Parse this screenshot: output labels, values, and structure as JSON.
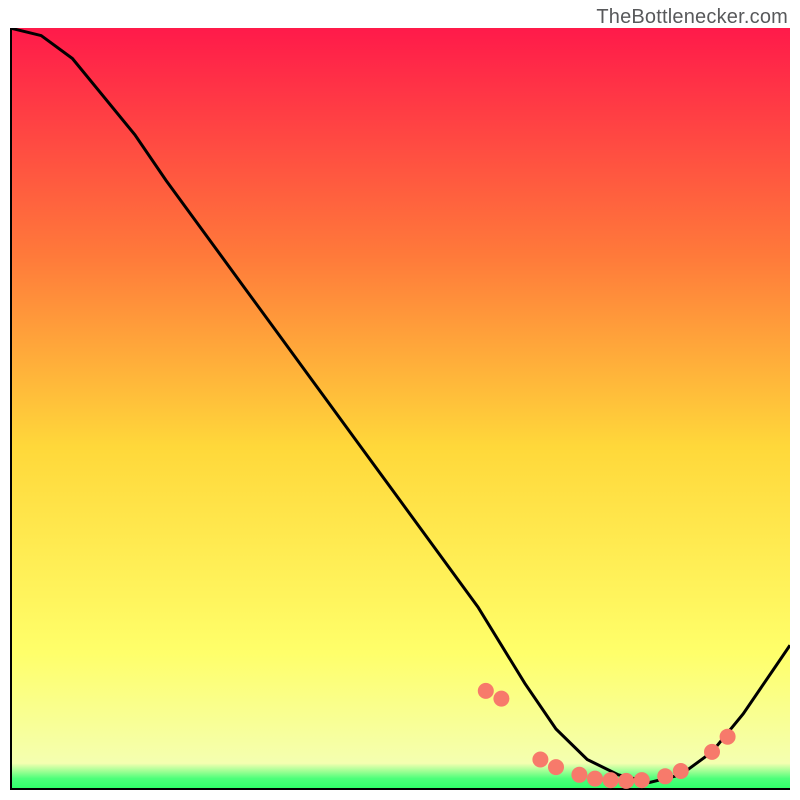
{
  "source_label": "TheBottlenecker.com",
  "colors": {
    "gradient_top": "#ff1a4a",
    "gradient_mid_top": "#ff7a3a",
    "gradient_mid": "#ffd83a",
    "gradient_mid_bottom": "#ffff6a",
    "gradient_bottom": "#4dff7a",
    "curve": "#000000",
    "axis": "#000000",
    "points": "#f77a6b"
  },
  "chart_data": {
    "type": "line",
    "title": "",
    "xlabel": "",
    "ylabel": "",
    "xlim": [
      0,
      100
    ],
    "ylim": [
      0,
      100
    ],
    "curve": {
      "x": [
        0,
        4,
        8,
        12,
        16,
        20,
        25,
        30,
        35,
        40,
        45,
        50,
        55,
        60,
        63,
        66,
        70,
        74,
        78,
        82,
        86,
        90,
        94,
        98,
        100
      ],
      "y": [
        100,
        99,
        96,
        91,
        86,
        80,
        73,
        66,
        59,
        52,
        45,
        38,
        31,
        24,
        19,
        14,
        8,
        4,
        2,
        1,
        2,
        5,
        10,
        16,
        19
      ]
    },
    "points": {
      "x": [
        61,
        63,
        68,
        70,
        73,
        75,
        77,
        79,
        81,
        84,
        86,
        90,
        92
      ],
      "y": [
        13,
        12,
        4,
        3,
        2,
        1.5,
        1.3,
        1.2,
        1.3,
        1.8,
        2.5,
        5,
        7
      ]
    },
    "annotations": []
  }
}
